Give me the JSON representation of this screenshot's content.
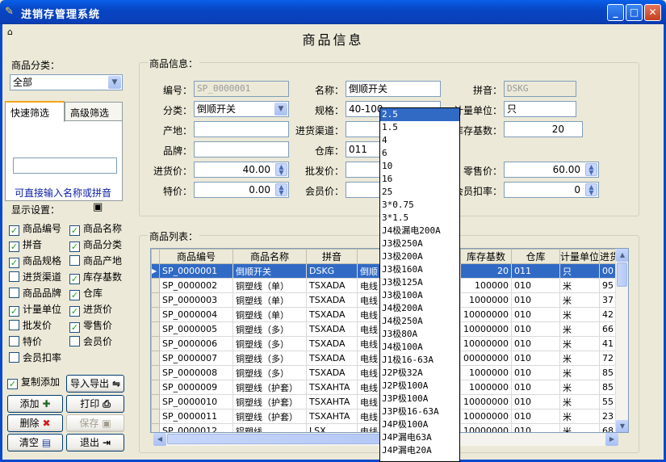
{
  "window": {
    "title": "进销存管理系统",
    "minimize": "_",
    "maximize": "□",
    "close": "✕"
  },
  "header": {
    "title": "商品信息"
  },
  "category": {
    "label": "商品分类：",
    "value": "全部"
  },
  "filter_tabs": [
    {
      "label": "快速筛选"
    },
    {
      "label": "高级筛选"
    }
  ],
  "filter": {
    "search_value": "",
    "hint": "可直接输入名称或拼音"
  },
  "display_settings": {
    "label": "显示设置：",
    "items": [
      {
        "label": "商品编号",
        "checked": true
      },
      {
        "label": "商品名称",
        "checked": true
      },
      {
        "label": "拼音",
        "checked": true
      },
      {
        "label": "商品分类",
        "checked": true
      },
      {
        "label": "商品规格",
        "checked": true
      },
      {
        "label": "商品产地",
        "checked": false
      },
      {
        "label": "进货渠道",
        "checked": false
      },
      {
        "label": "库存基数",
        "checked": true
      },
      {
        "label": "商品品牌",
        "checked": false
      },
      {
        "label": "仓库",
        "checked": true
      },
      {
        "label": "计量单位",
        "checked": true
      },
      {
        "label": "进货价",
        "checked": true
      },
      {
        "label": "批发价",
        "checked": false
      },
      {
        "label": "零售价",
        "checked": true
      },
      {
        "label": "特价",
        "checked": false
      },
      {
        "label": "会员价",
        "checked": false
      },
      {
        "label": "会员扣率",
        "checked": false
      }
    ]
  },
  "actions": {
    "copy_add": {
      "label": "复制添加",
      "checked": true
    },
    "import_export": "导入导出",
    "add": "添加",
    "print": "打印",
    "delete": "删除",
    "save": "保存",
    "clear": "清空",
    "exit": "退出"
  },
  "info": {
    "group_label": "商品信息：",
    "code_label": "编号：",
    "code_value": "SP_0000001",
    "name_label": "名称：",
    "name_value": "倒顺开关",
    "pinyin_label": "拼音：",
    "pinyin_value": "DSKG",
    "category_label": "分类：",
    "category_value": "倒顺开关",
    "spec_label": "规格：",
    "spec_value": "40-100",
    "unit_label": "计量单位：",
    "unit_value": "只",
    "origin_label": "产地：",
    "origin_value": "",
    "channel_label": "进货渠道：",
    "channel_value": "",
    "stock_label": "库存基数：",
    "stock_value": "20",
    "brand_label": "品牌：",
    "brand_value": "",
    "warehouse_label": "仓库：",
    "warehouse_value": "011",
    "purchase_label": "进货价：",
    "purchase_value": "40.00",
    "wholesale_label": "批发价：",
    "wholesale_value": "",
    "retail_label": "零售价：",
    "retail_value": "60.00",
    "special_label": "特价：",
    "special_value": "0.00",
    "member_label": "会员价：",
    "member_value": "",
    "discount_label": "会员扣率：",
    "discount_value": "0"
  },
  "list": {
    "group_label": "商品列表：",
    "columns": [
      "商品编号",
      "商品名称",
      "拼音",
      "商品",
      "库存基数",
      "仓库",
      "计量单位",
      "进货"
    ],
    "rows": [
      [
        "SP_0000001",
        "倒顺开关",
        "DSKG",
        "倒顺",
        "20",
        "011",
        "只",
        "00"
      ],
      [
        "SP_0000002",
        "铜塑线（单）",
        "TSXADA",
        "电线",
        "100000",
        "010",
        "米",
        "95"
      ],
      [
        "SP_0000003",
        "铜塑线（单）",
        "TSXADA",
        "电线",
        "1000000",
        "010",
        "米",
        "37"
      ],
      [
        "SP_0000004",
        "铜塑线（单）",
        "TSXADA",
        "电线",
        "10000000",
        "010",
        "米",
        "42"
      ],
      [
        "SP_0000005",
        "铜塑线（多）",
        "TSXADA",
        "电线",
        "10000000",
        "010",
        "米",
        "66"
      ],
      [
        "SP_0000006",
        "铜塑线（多）",
        "TSXADA",
        "电线",
        "10000000",
        "010",
        "米",
        "41"
      ],
      [
        "SP_0000007",
        "铜塑线（多）",
        "TSXADA",
        "电线",
        "00000000",
        "010",
        "米",
        "72"
      ],
      [
        "SP_0000008",
        "铜塑线（多）",
        "TSXADA",
        "电线",
        "1000000",
        "010",
        "米",
        "85"
      ],
      [
        "SP_0000009",
        "铜塑线（护套）",
        "TSXAHTA",
        "电线",
        "1000000",
        "010",
        "米",
        "85"
      ],
      [
        "SP_0000010",
        "铜塑线（护套）",
        "TSXAHTA",
        "电线",
        "10000000",
        "010",
        "米",
        "55"
      ],
      [
        "SP_0000011",
        "铜塑线（护套）",
        "TSXAHTA",
        "电线",
        "10000000",
        "010",
        "米",
        "23"
      ],
      [
        "SP_0000012",
        "铝塑线",
        "LSX",
        "电线",
        "10000000",
        "010",
        "米",
        "68"
      ]
    ]
  },
  "spec_dropdown": [
    "2.5",
    "1.5",
    "4",
    "6",
    "10",
    "16",
    "25",
    "3*0.75",
    "3*1.5",
    "J4极漏电200A",
    "J3极250A",
    "J3极200A",
    "J3极160A",
    "J3极125A",
    "J3极100A",
    "J4极200A",
    "J4极250A",
    "J3极80A",
    "J4极100A",
    "J1极16-63A",
    "J2P极32A",
    "J2P极100A",
    "J3P极100A",
    "J3P极16-63A",
    "J4P极100A",
    "J4P漏电63A",
    "J4P漏电20A"
  ]
}
